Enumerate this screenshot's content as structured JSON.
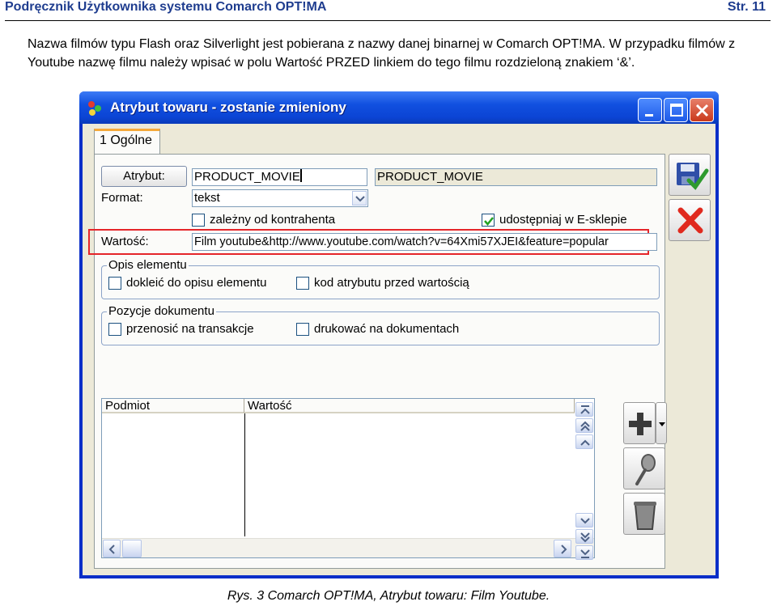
{
  "document": {
    "header_title": "Podręcznik Użytkownika systemu Comarch OPT!MA",
    "page_number": "Str. 11",
    "paragraph_line1": "Nazwa filmów typu Flash oraz Silverlight jest pobierana z nazwy danej binarnej w Comarch OPT!MA. W przypadku filmów z",
    "paragraph_line2": "Youtube nazwę filmu należy wpisać w polu Wartość PRZED linkiem do tego filmu rozdzieloną znakiem ‘&’.",
    "caption": "Rys. 3 Comarch OPT!MA, Atrybut towaru: Film Youtube."
  },
  "window": {
    "title": "Atrybut towaru - zostanie zmieniony",
    "tab_label": "1 Ogólne"
  },
  "form": {
    "attribute_button": "Atrybut:",
    "attribute_code": "PRODUCT_MOVIE",
    "attribute_name": "PRODUCT_MOVIE",
    "format_label": "Format:",
    "format_value": "tekst",
    "contractor_dependent_label": "zależny od kontrahenta",
    "contractor_dependent_checked": false,
    "eshop_share_label": "udostępniaj w E-sklepie",
    "eshop_share_checked": true,
    "value_label": "Wartość:",
    "value_text": "Film youtube&http://www.youtube.com/watch?v=64Xmi57XJEI&feature=popular"
  },
  "description_group": {
    "title": "Opis elementu",
    "option1": "doklеić do opisu elementu",
    "option2": "kod atrybutu przed wartością"
  },
  "documents_group": {
    "title": "Pozycje dokumentu",
    "option1": "przenosić na transakcje",
    "option2": "drukować na dokumentach"
  },
  "list": {
    "columns": [
      "Podmiot",
      "Wartość"
    ]
  },
  "colors": {
    "titlebar": "#0b44d4",
    "highlight": "#e5252a",
    "tab_accent": "#f5a93a"
  },
  "icons": {
    "save": "save-check-icon",
    "cancel": "red-x-icon",
    "add": "plus-icon",
    "edit": "magnifier-icon",
    "delete": "trash-icon"
  }
}
